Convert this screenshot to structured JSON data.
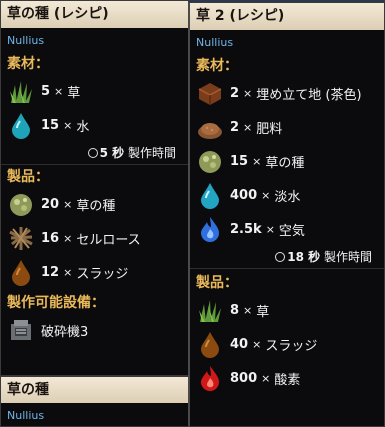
{
  "left_card": {
    "title": "草の種 (レシピ)",
    "owner": "Nullius",
    "materials_label": "素材：",
    "materials": [
      {
        "qty": "5",
        "name": "草",
        "icon": "grass-icon"
      },
      {
        "qty": "15",
        "name": "水",
        "icon": "water-drop-icon"
      }
    ],
    "time_value": "5 秒",
    "time_label": "製作時間",
    "products_label": "製品：",
    "products": [
      {
        "qty": "20",
        "name": "草の種",
        "icon": "seed-icon"
      },
      {
        "qty": "16",
        "name": "セルロース",
        "icon": "cellulose-icon"
      },
      {
        "qty": "12",
        "name": "スラッジ",
        "icon": "sludge-drop-icon"
      }
    ],
    "machines_label": "製作可能設備：",
    "machines": [
      {
        "name": "破砕機3",
        "icon": "crusher-icon"
      }
    ]
  },
  "left_card2": {
    "title": "草の種",
    "owner": "Nullius"
  },
  "right_card": {
    "title": "草 2 (レシピ)",
    "owner": "Nullius",
    "materials_label": "素材：",
    "materials": [
      {
        "qty": "2",
        "name": "埋め立て地 (茶色)",
        "icon": "landfill-icon"
      },
      {
        "qty": "2",
        "name": "肥料",
        "icon": "fertilizer-icon"
      },
      {
        "qty": "15",
        "name": "草の種",
        "icon": "seed-icon"
      },
      {
        "qty": "400",
        "name": "淡水",
        "icon": "fresh-water-drop-icon"
      },
      {
        "qty": "2.5k",
        "name": "空気",
        "icon": "air-flame-icon"
      }
    ],
    "time_value": "18 秒",
    "time_label": "製作時間",
    "products_label": "製品：",
    "products": [
      {
        "qty": "8",
        "name": "草",
        "icon": "grass-icon"
      },
      {
        "qty": "40",
        "name": "スラッジ",
        "icon": "sludge-drop-icon"
      },
      {
        "qty": "800",
        "name": "酸素",
        "icon": "oxygen-flame-icon"
      }
    ]
  },
  "separator": "×"
}
